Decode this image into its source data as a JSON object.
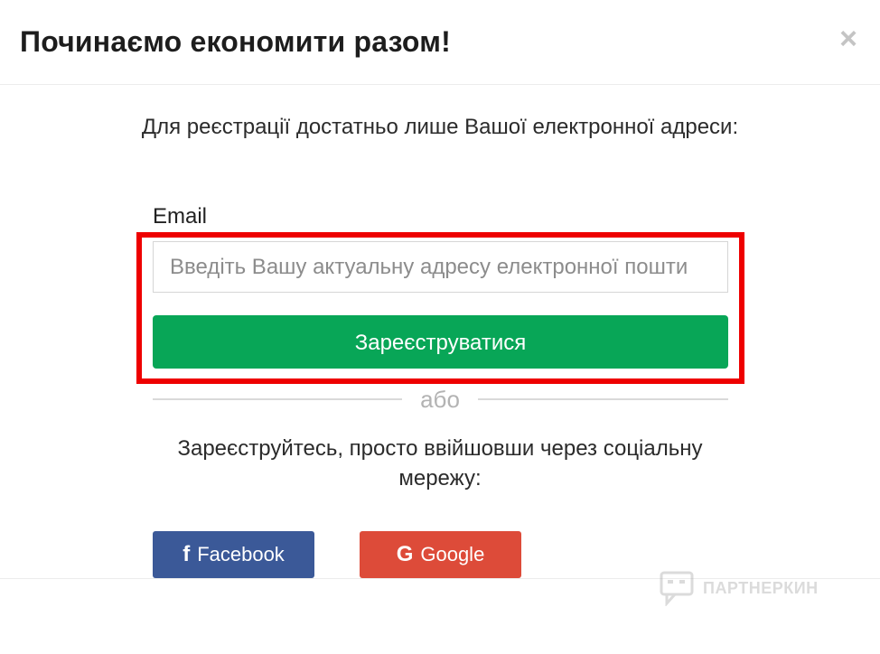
{
  "modal": {
    "title": "Починаємо економити разом!",
    "close_symbol": "×",
    "intro_text": "Для реєстрації достатньо лише Вашої електронної адреси:"
  },
  "form": {
    "email_label": "Email",
    "email_value": "",
    "email_placeholder": "Введіть Вашу актуальну адресу електронної пошти",
    "submit_label": "Зареєструватися"
  },
  "divider": {
    "text": "або"
  },
  "social": {
    "prompt": "Зареєструйтесь, просто ввійшовши через соціальну мережу:",
    "facebook": {
      "icon": "facebook-icon",
      "glyph": "f",
      "label": "Facebook",
      "color": "#3b5998"
    },
    "google": {
      "icon": "google-icon",
      "glyph": "G",
      "label": "Google",
      "color": "#dd4b39"
    }
  },
  "watermark": {
    "text": "ПАРТНЕРКИН"
  },
  "colors": {
    "accent_green": "#08a657",
    "highlight_red": "#ee0000"
  }
}
